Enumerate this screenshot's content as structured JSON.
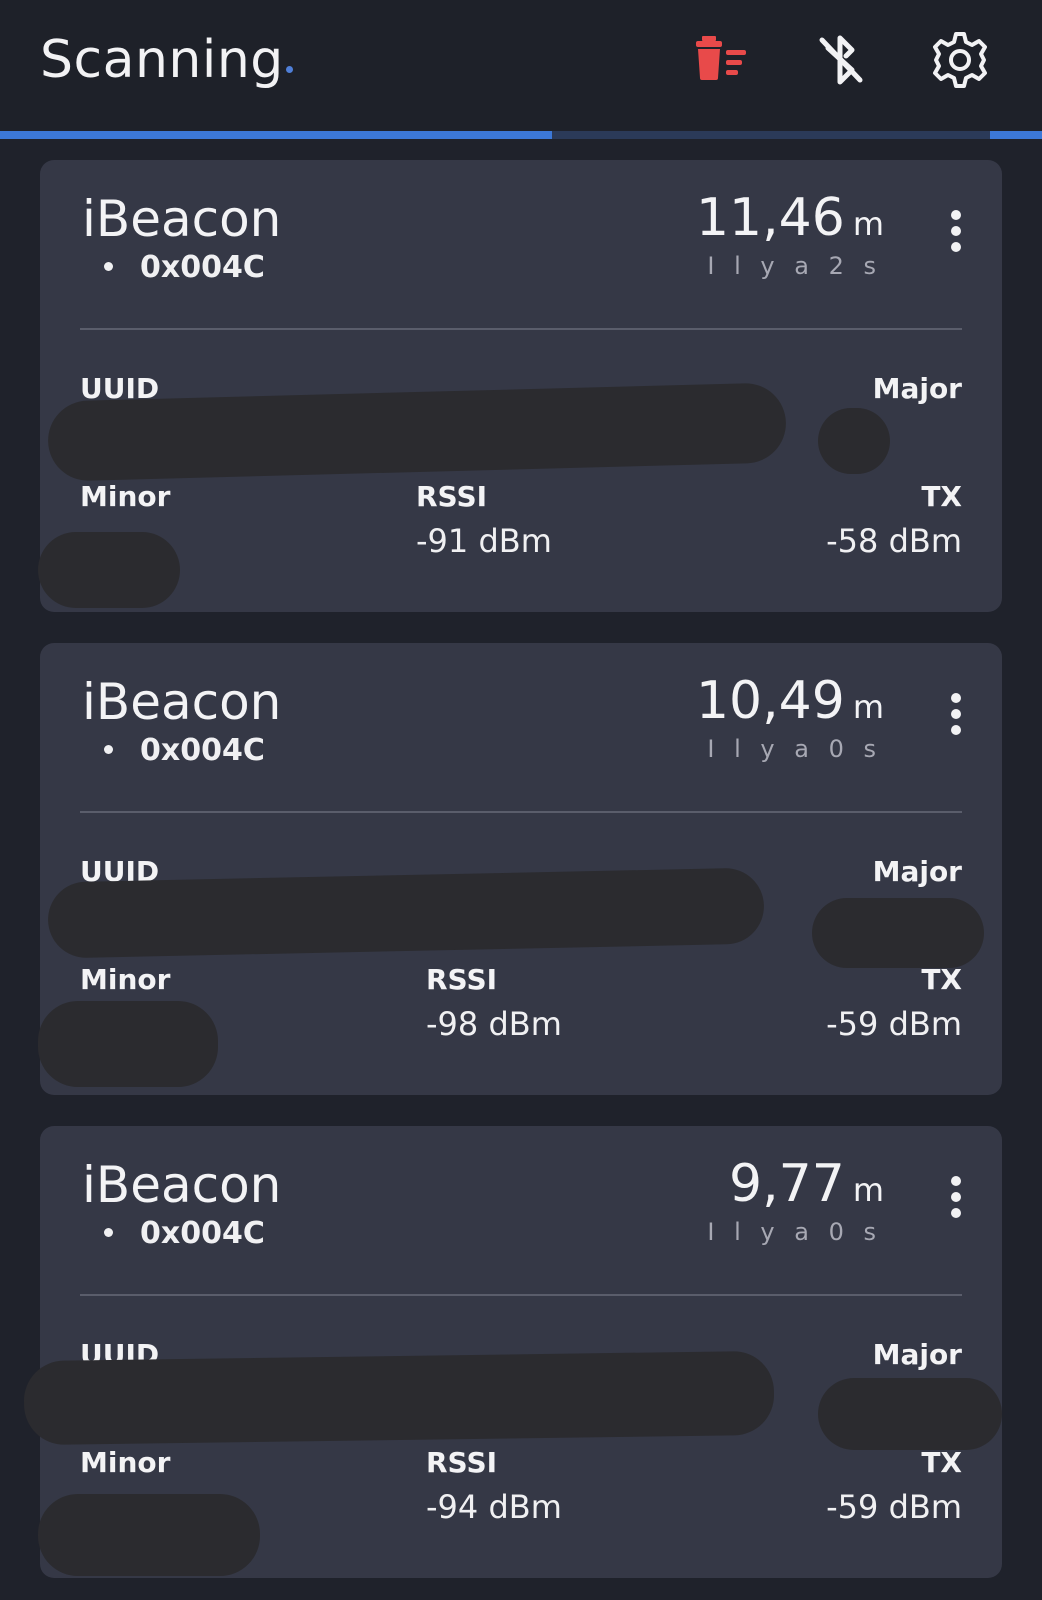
{
  "appbar": {
    "title": "Scanning",
    "progress_fraction": 0.53,
    "accent_color": "#3c78d8",
    "icons": [
      "clear-list-icon",
      "bluetooth-off-icon",
      "settings-icon"
    ]
  },
  "beacons": [
    {
      "type": "iBeacon",
      "manufacturer": "0x004C",
      "distance": "11,46",
      "distance_unit": "m",
      "interval": "I l y a 2 s",
      "uuid_label": "UUID",
      "major_label": "Major",
      "minor_label": "Minor",
      "rssi_label": "RSSI",
      "rssi": "-91 dBm",
      "tx_label": "TX",
      "tx": "-58 dBm"
    },
    {
      "type": "iBeacon",
      "manufacturer": "0x004C",
      "distance": "10,49",
      "distance_unit": "m",
      "interval": "I l y a 0 s",
      "uuid_label": "UUID",
      "major_label": "Major",
      "minor_label": "Minor",
      "rssi_label": "RSSI",
      "rssi": "-98 dBm",
      "tx_label": "TX",
      "tx": "-59 dBm"
    },
    {
      "type": "iBeacon",
      "manufacturer": "0x004C",
      "distance": "9,77",
      "distance_unit": "m",
      "interval": "I l y a 0 s",
      "uuid_label": "UUID",
      "major_label": "Major",
      "minor_label": "Minor",
      "rssi_label": "RSSI",
      "rssi": "-94 dBm",
      "tx_label": "TX",
      "tx": "-59 dBm"
    }
  ]
}
